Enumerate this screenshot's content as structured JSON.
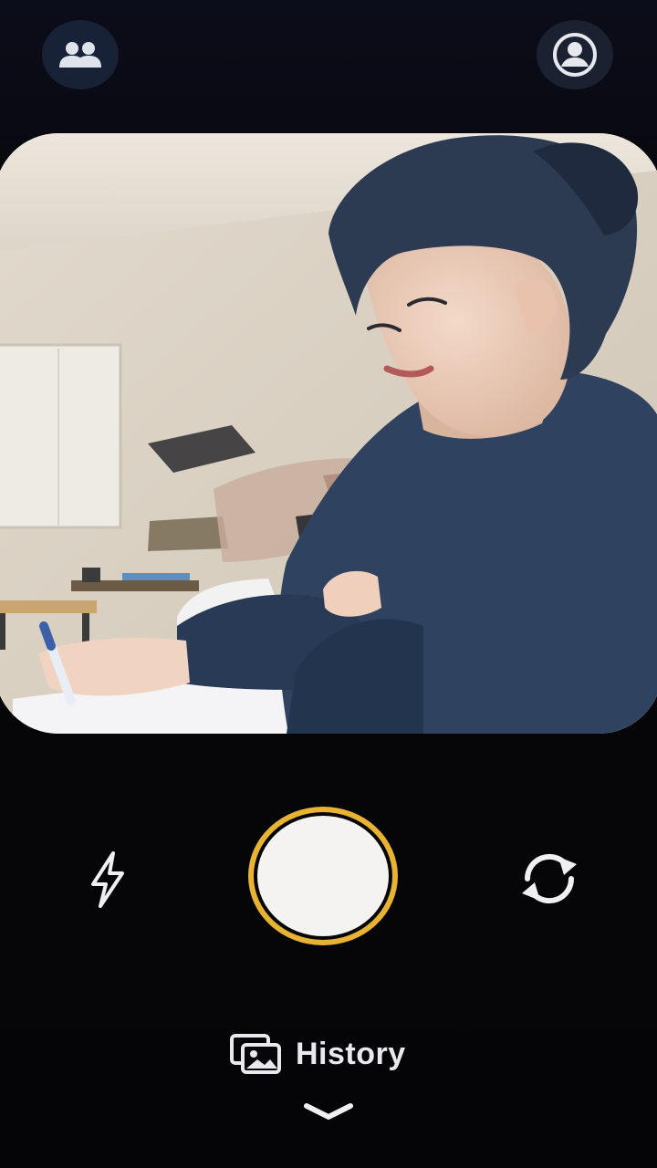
{
  "top_bar": {
    "friends_icon": "friends-icon",
    "profile_icon": "profile-icon"
  },
  "camera": {
    "flash_icon": "flash-icon",
    "flip_icon": "flip-camera-icon",
    "shutter_ring_color": "#e8b233"
  },
  "history": {
    "label": "History",
    "icon": "gallery-icon",
    "expand_icon": "chevron-down-icon"
  }
}
